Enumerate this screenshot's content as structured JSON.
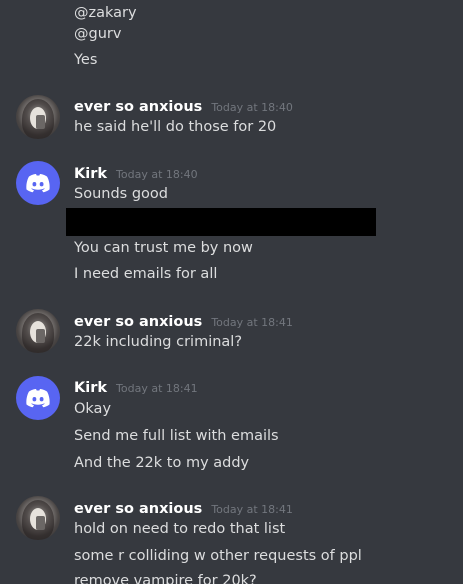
{
  "theme": {
    "background": "#36393f",
    "text": "#dcddde",
    "author": "#ffffff",
    "timestamp": "#72767d",
    "discord_blurple": "#5865f2",
    "redaction": "#000000"
  },
  "messages": {
    "m0": {
      "lines": [
        "@zakary",
        "@gurv",
        "Yes"
      ]
    },
    "m1": {
      "author": "ever so anxious",
      "avatar": "photo-avatar",
      "timestamp": "Today at 18:40",
      "lines": [
        "he said he'll do those for 20"
      ]
    },
    "m2": {
      "author": "Kirk",
      "avatar": "discord-logo-icon",
      "timestamp": "Today at 18:40",
      "lines": [
        "Sounds good",
        "You can trust me by now",
        "I need emails for all"
      ]
    },
    "m3": {
      "author": "ever so anxious",
      "avatar": "photo-avatar",
      "timestamp": "Today at 18:41",
      "lines": [
        "22k including criminal?"
      ]
    },
    "m4": {
      "author": "Kirk",
      "avatar": "discord-logo-icon",
      "timestamp": "Today at 18:41",
      "lines": [
        "Okay",
        "Send me full list with emails",
        "And the 22k to my addy"
      ]
    },
    "m5": {
      "author": "ever so anxious",
      "avatar": "photo-avatar",
      "timestamp": "Today at 18:41",
      "lines": [
        "hold on need to redo that list",
        "some r colliding w other requests of ppl",
        "remove vampire for 20k?"
      ]
    }
  }
}
